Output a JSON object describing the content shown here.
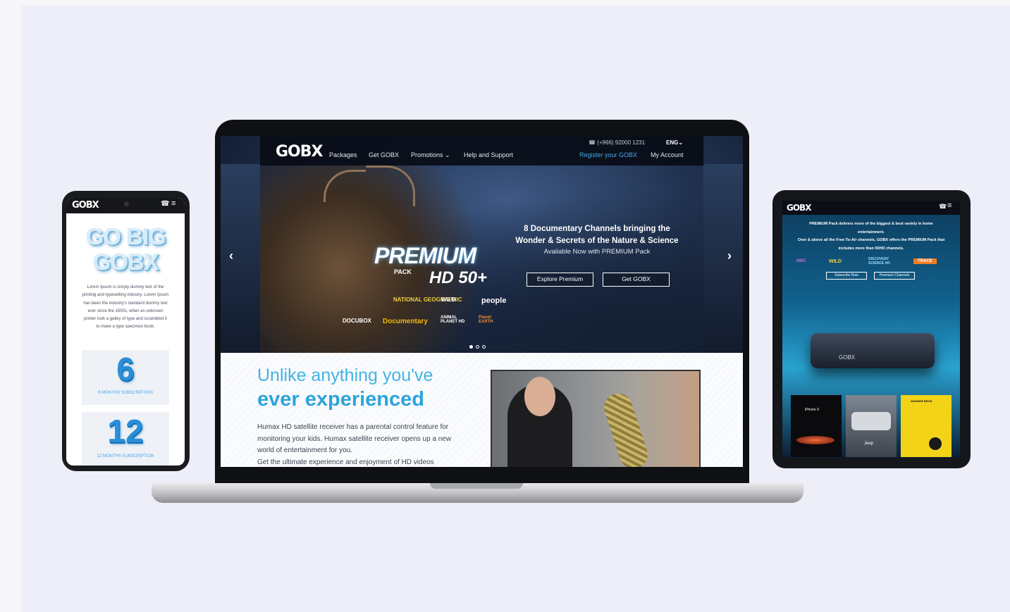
{
  "laptop": {
    "nav": {
      "logo": "GOBX",
      "links": [
        "Packages",
        "Get GOBX",
        "Promotions",
        "Help and Support"
      ],
      "phone": "(+966) 92000 1231",
      "lang": "ENG",
      "register": "Register your GOBX",
      "account": "My Account"
    },
    "hero": {
      "headline_1": "8 Documentary Channels bringing the",
      "headline_2": "Wonder & Secrets of the Nature & Science",
      "subline": "Available Now with PREMIUM Pack",
      "button_explore": "Explore Premium",
      "button_get": "Get GOBX",
      "premium_word": "PREMIUM",
      "pack_word": "PACK",
      "hd_badge": "HD 50+",
      "channels": [
        "NATIONAL GEOGRAPHIC",
        "WILD",
        "people",
        "DOCUBOX",
        "Documentary",
        "ANIMAL PLANET HD",
        "Planet EARTH"
      ]
    },
    "content": {
      "title_light": "Unlike anything you've",
      "title_bold": "ever experienced",
      "paragraph": "Humax HD satellite receiver has a parental control feature for monitoring your kids. Humax satellite receiver opens up a new world of entertainment for you.",
      "cut_line": "Get the ultimate experience and enjoyment of HD videos"
    }
  },
  "phone": {
    "logo": "GOBX",
    "big_1": "GO BIG",
    "big_2": "GOBX",
    "body": "Lorem Ipsum is simply dummy text of the printing and typesetting industry. Lorem Ipsum has been the industry's standard dummy text ever since the 1500s, when an unknown printer took a galley of type and scrambled it to make a type specimen book.",
    "cards": [
      {
        "num": "6",
        "label_a": "6 MONTHS",
        "label_b": "SUBSCRIPTION"
      },
      {
        "num": "12",
        "label_a": "12 MONTHS",
        "label_b": "SUBSCRIPTION"
      }
    ]
  },
  "tablet": {
    "logo": "GOBX",
    "line_1": "PREMIUM Pack delivers more of the biggest & best variety in home",
    "line_2": "entertainment.",
    "line_3": "Over & above all the Free-To-Air channels, GOBX offers the PREMIUM Pack that",
    "line_4": "includes more than 50HD channels.",
    "channels": [
      "MBC",
      "WILD",
      "DISCOVERY SCIENCE HD",
      "TRACE"
    ],
    "button_subscribe": "Subscribe Now",
    "button_channels": "Premium Channels",
    "box_label": "GOBX",
    "tiles": [
      "iPhone X",
      "Jeep",
      "WARNER BROS"
    ]
  },
  "colors": {
    "accent": "#2da4dc",
    "background": "#eeeef9",
    "device": "#16171b"
  }
}
